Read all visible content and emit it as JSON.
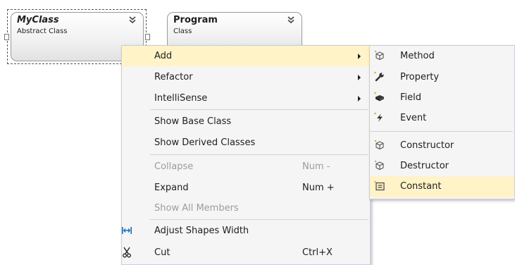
{
  "shapes": {
    "myclass": {
      "name": "MyClass",
      "kind": "Abstract Class"
    },
    "program": {
      "name": "Program",
      "kind": "Class"
    }
  },
  "context_menu": {
    "add": "Add",
    "refactor": "Refactor",
    "intellisense": "IntelliSense",
    "show_base_class": "Show Base Class",
    "show_derived_classes": "Show Derived Classes",
    "collapse": {
      "label": "Collapse",
      "shortcut": "Num -"
    },
    "expand": {
      "label": "Expand",
      "shortcut": "Num +"
    },
    "show_all_members": "Show All Members",
    "adjust_shapes_width": "Adjust Shapes Width",
    "cut": {
      "label": "Cut",
      "shortcut": "Ctrl+X"
    }
  },
  "add_submenu": {
    "method": "Method",
    "property": "Property",
    "field": "Field",
    "event": "Event",
    "constructor": "Constructor",
    "destructor": "Destructor",
    "constant": "Constant"
  },
  "colors": {
    "highlight": "#fff3c7",
    "menu_background": "#f5f5f5",
    "disabled_text": "#9c9c9c",
    "icon_blue": "#1f6fb5"
  }
}
